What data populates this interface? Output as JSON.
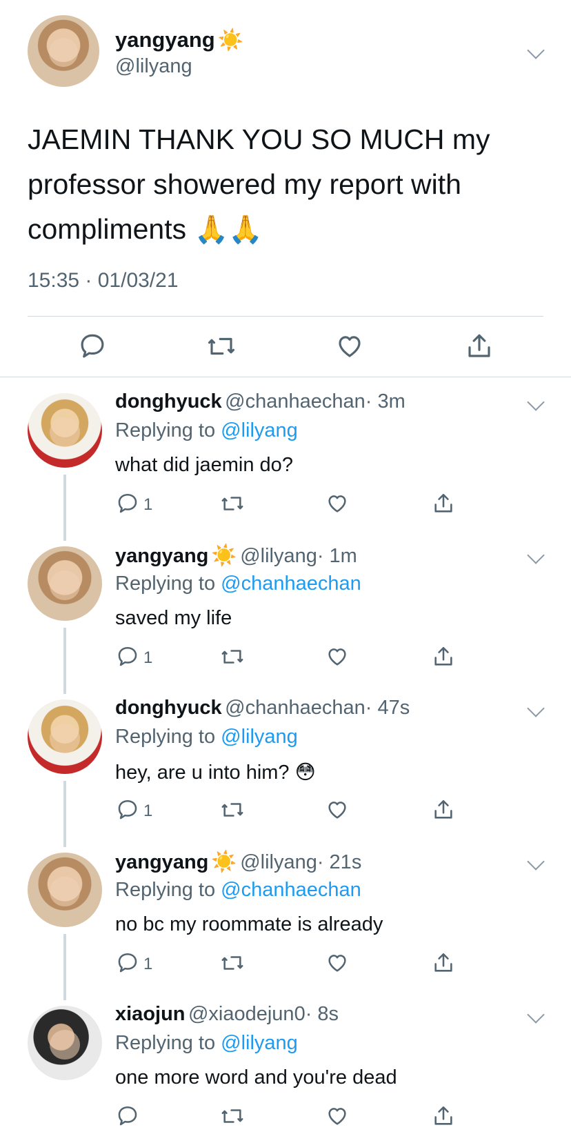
{
  "main_tweet": {
    "name": "yangyang",
    "name_emoji": "☀️",
    "handle": "@lilyang",
    "text": "JAEMIN THANK YOU SO MUCH my professor showered my report with compliments",
    "text_emoji": "🙏🙏",
    "timestamp": "15:35 · 01/03/21"
  },
  "replies": [
    {
      "name": "donghyuck",
      "name_emoji": "",
      "handle": "@chanhaechan",
      "time": "· 3m",
      "replying_prefix": "Replying to",
      "replying_to": "@lilyang",
      "text": "what did jaemin do?",
      "text_emoji": "",
      "reply_count": "1"
    },
    {
      "name": "yangyang",
      "name_emoji": "☀️",
      "handle": "@lilyang",
      "time": "· 1m",
      "replying_prefix": "Replying to",
      "replying_to": "@chanhaechan",
      "text": "saved my life",
      "text_emoji": "",
      "reply_count": "1"
    },
    {
      "name": "donghyuck",
      "name_emoji": "",
      "handle": "@chanhaechan",
      "time": "· 47s",
      "replying_prefix": "Replying to",
      "replying_to": "@lilyang",
      "text": "hey, are u into him?",
      "text_emoji": "😳",
      "reply_count": "1"
    },
    {
      "name": "yangyang",
      "name_emoji": "☀️",
      "handle": "@lilyang",
      "time": "· 21s",
      "replying_prefix": "Replying to",
      "replying_to": "@chanhaechan",
      "text": "no bc my roommate is already",
      "text_emoji": "",
      "reply_count": "1"
    },
    {
      "name": "xiaojun",
      "name_emoji": "",
      "handle": "@xiaodejun0",
      "time": "· 8s",
      "replying_prefix": "Replying to",
      "replying_to": "@lilyang",
      "text": "one more word and you're dead",
      "text_emoji": "",
      "reply_count": ""
    }
  ],
  "icons": {
    "reply": "reply-icon",
    "retweet": "retweet-icon",
    "like": "like-icon",
    "share": "share-icon",
    "more": "chevron-down-icon"
  },
  "colors": {
    "text": "#0f1419",
    "secondary": "#536471",
    "link": "#1d9bf0",
    "divider": "#cfd9de"
  }
}
